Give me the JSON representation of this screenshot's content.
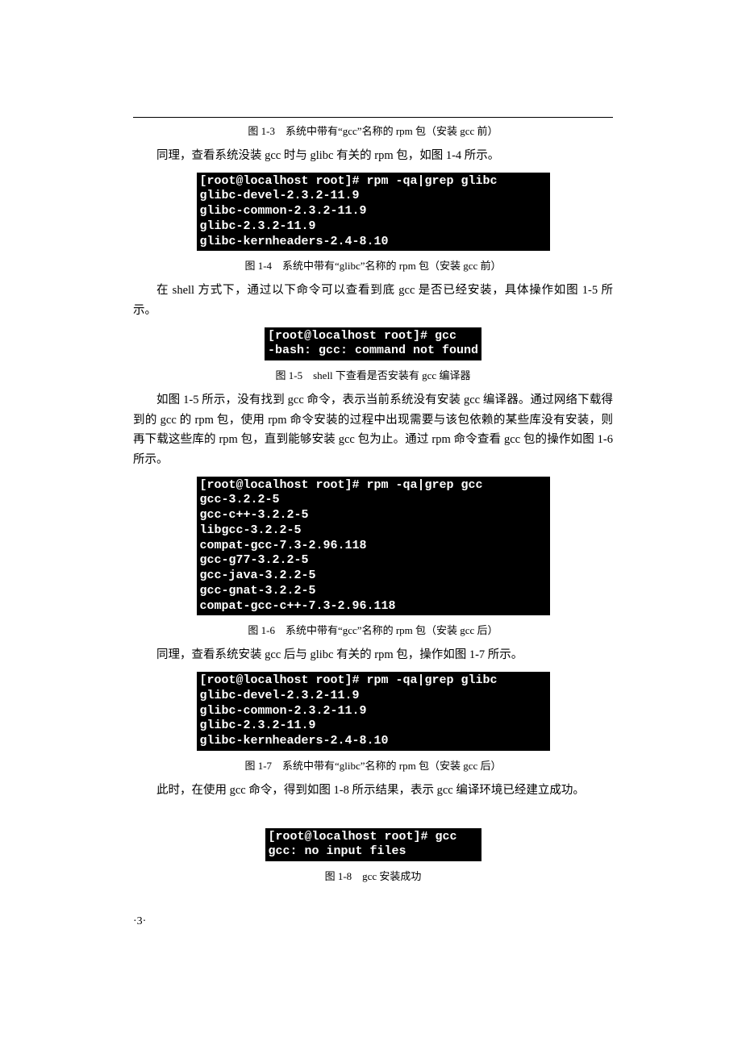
{
  "captions": {
    "fig_1_3": "图 1-3　系统中带有“gcc”名称的 rpm 包（安装 gcc 前）",
    "fig_1_4": "图 1-4　系统中带有“glibc”名称的 rpm 包（安装 gcc 前）",
    "fig_1_5": "图 1-5　shell 下查看是否安装有 gcc 编译器",
    "fig_1_6": "图 1-6　系统中带有“gcc”名称的 rpm 包（安装 gcc 后）",
    "fig_1_7": "图 1-7　系统中带有“glibc”名称的 rpm 包（安装 gcc 后）",
    "fig_1_8": "图 1-8　gcc 安装成功"
  },
  "paragraphs": {
    "p1": "同理，查看系统没装 gcc 时与 glibc 有关的 rpm 包，如图 1-4 所示。",
    "p2": "在 shell 方式下，通过以下命令可以查看到底 gcc 是否已经安装，具体操作如图 1-5 所示。",
    "p3": "如图 1-5 所示，没有找到 gcc 命令，表示当前系统没有安装 gcc 编译器。通过网络下载得到的 gcc 的 rpm 包，使用 rpm 命令安装的过程中出现需要与该包依赖的某些库没有安装，则再下载这些库的 rpm 包，直到能够安装 gcc 包为止。通过 rpm 命令查看 gcc 包的操作如图 1-6 所示。",
    "p4": "同理，查看系统安装 gcc 后与 glibc 有关的 rpm 包，操作如图 1-7 所示。",
    "p5": "此时，在使用 gcc 命令，得到如图 1-8 所示结果，表示 gcc 编译环境已经建立成功。"
  },
  "terminals": {
    "t_1_4": "[root@localhost root]# rpm -qa|grep glibc\nglibc-devel-2.3.2-11.9\nglibc-common-2.3.2-11.9\nglibc-2.3.2-11.9\nglibc-kernheaders-2.4-8.10",
    "t_1_5": "[root@localhost root]# gcc\n-bash: gcc: command not found",
    "t_1_6": "[root@localhost root]# rpm -qa|grep gcc\ngcc-3.2.2-5\ngcc-c++-3.2.2-5\nlibgcc-3.2.2-5\ncompat-gcc-7.3-2.96.118\ngcc-g77-3.2.2-5\ngcc-java-3.2.2-5\ngcc-gnat-3.2.2-5\ncompat-gcc-c++-7.3-2.96.118",
    "t_1_7": "[root@localhost root]# rpm -qa|grep glibc\nglibc-devel-2.3.2-11.9\nglibc-common-2.3.2-11.9\nglibc-2.3.2-11.9\nglibc-kernheaders-2.4-8.10",
    "t_1_8": "[root@localhost root]# gcc\ngcc: no input files"
  },
  "page_number": "·3·"
}
